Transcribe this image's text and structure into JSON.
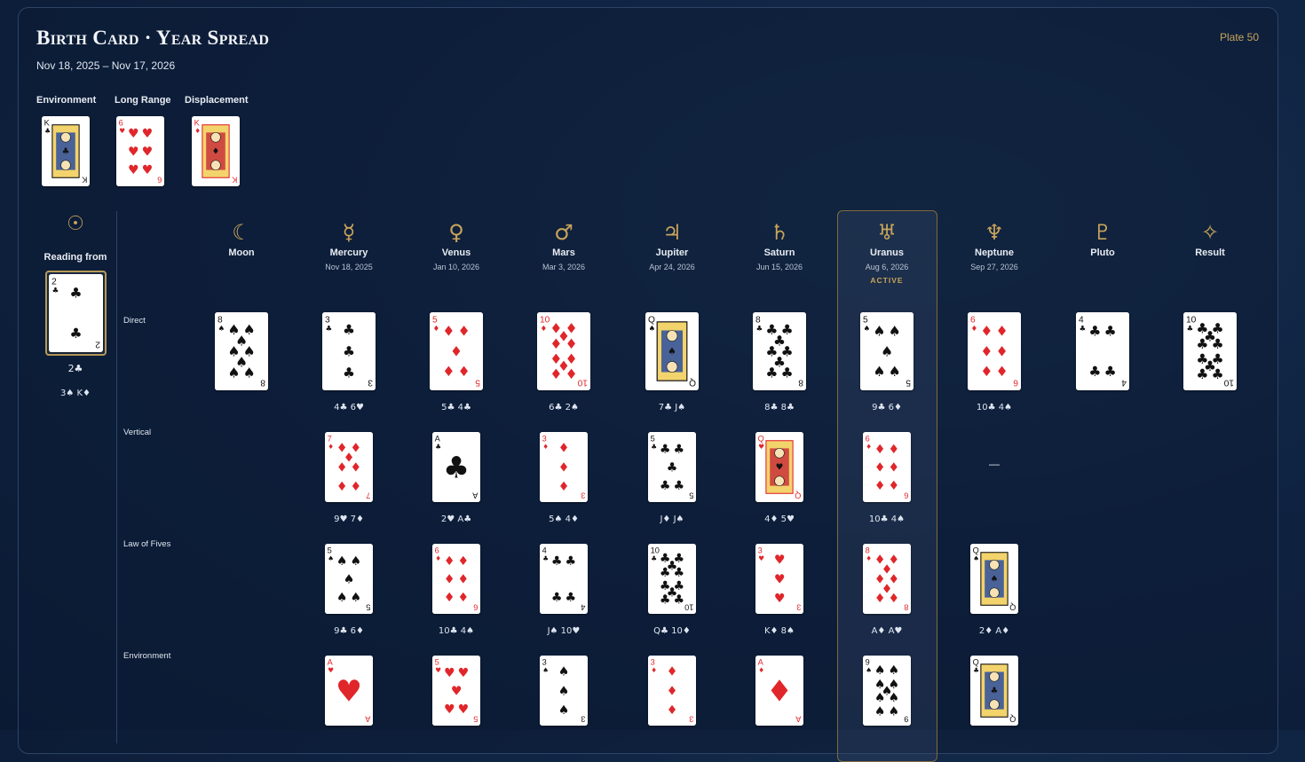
{
  "header": {
    "title": "Birth Card · Year Spread",
    "date_range": "Nov 18, 2025 – Nov 17, 2026",
    "plate": "Plate 50"
  },
  "top_cards": [
    {
      "label": "Environment",
      "card": "K♣"
    },
    {
      "label": "Long Range",
      "card": "6♥"
    },
    {
      "label": "Displacement",
      "card": "K♦"
    }
  ],
  "reading_from": {
    "icon": "sun-icon",
    "label": "Reading from",
    "card": "2♣",
    "card_name": "2♣",
    "pair": "3♠  K♦"
  },
  "row_labels": [
    "Direct",
    "Vertical",
    "Law of Fives",
    "Environment"
  ],
  "planets": [
    {
      "key": "moon",
      "icon": "moon-icon",
      "glyph": "☾",
      "name": "Moon",
      "date": "",
      "active": false
    },
    {
      "key": "mercury",
      "icon": "mercury-icon",
      "glyph": "☿",
      "name": "Mercury",
      "date": "Nov 18, 2025",
      "active": false
    },
    {
      "key": "venus",
      "icon": "venus-icon",
      "glyph": "♀",
      "name": "Venus",
      "date": "Jan 10, 2026",
      "active": false
    },
    {
      "key": "mars",
      "icon": "mars-icon",
      "glyph": "♂",
      "name": "Mars",
      "date": "Mar 3, 2026",
      "active": false
    },
    {
      "key": "jupiter",
      "icon": "jupiter-icon",
      "glyph": "♃",
      "name": "Jupiter",
      "date": "Apr 24, 2026",
      "active": false
    },
    {
      "key": "saturn",
      "icon": "saturn-icon",
      "glyph": "♄",
      "name": "Saturn",
      "date": "Jun 15, 2026",
      "active": false
    },
    {
      "key": "uranus",
      "icon": "uranus-icon",
      "glyph": "♅",
      "name": "Uranus",
      "date": "Aug 6, 2026",
      "active": true
    },
    {
      "key": "neptune",
      "icon": "neptune-icon",
      "glyph": "♆",
      "name": "Neptune",
      "date": "Sep 27, 2026",
      "active": false
    },
    {
      "key": "pluto",
      "icon": "pluto-icon",
      "glyph": "♇",
      "name": "Pluto",
      "date": "",
      "active": false
    },
    {
      "key": "result",
      "icon": "sparkle-icon",
      "glyph": "✧",
      "name": "Result",
      "date": "",
      "active": false
    }
  ],
  "active_label": "ACTIVE",
  "direct": [
    {
      "card": "8♠",
      "pair": ""
    },
    {
      "card": "3♣",
      "pair": "4♣  6♥"
    },
    {
      "card": "5♦",
      "pair": "5♣  4♣"
    },
    {
      "card": "10♦",
      "pair": "6♣  2♠"
    },
    {
      "card": "Q♠",
      "pair": "7♣  J♠"
    },
    {
      "card": "8♣",
      "pair": "8♣  8♣"
    },
    {
      "card": "5♠",
      "pair": "9♣  6♦"
    },
    {
      "card": "6♦",
      "pair": "10♣  4♠"
    },
    {
      "card": "4♣",
      "pair": ""
    },
    {
      "card": "10♣",
      "pair": ""
    }
  ],
  "vertical": [
    null,
    {
      "card": "7♦",
      "pair": "9♥  7♦"
    },
    {
      "card": "A♣",
      "pair": "2♥  A♣"
    },
    {
      "card": "3♦",
      "pair": "5♠  4♦"
    },
    {
      "card": "5♣",
      "pair": "J♦  J♠"
    },
    {
      "card": "Q♥",
      "pair": "4♦  5♥"
    },
    {
      "card": "6♦",
      "pair": "10♣  4♠"
    },
    {
      "card": "",
      "pair": "—"
    },
    null,
    null
  ],
  "law_of_fives": [
    null,
    {
      "card": "5♠",
      "pair": "9♣  6♦"
    },
    {
      "card": "6♦",
      "pair": "10♣  4♠"
    },
    {
      "card": "4♣",
      "pair": "J♠  10♥"
    },
    {
      "card": "10♣",
      "pair": "Q♣  10♦"
    },
    {
      "card": "3♥",
      "pair": "K♦  8♠"
    },
    {
      "card": "8♦",
      "pair": "A♦  A♥"
    },
    {
      "card": "Q♠",
      "pair": "2♦  A♦"
    },
    null,
    null
  ],
  "environment_row": [
    null,
    {
      "card": "A♥",
      "pair": ""
    },
    {
      "card": "5♥",
      "pair": ""
    },
    {
      "card": "3♠",
      "pair": ""
    },
    {
      "card": "3♦",
      "pair": ""
    },
    {
      "card": "A♦",
      "pair": ""
    },
    {
      "card": "9♠",
      "pair": ""
    },
    {
      "card": "Q♣",
      "pair": ""
    },
    null,
    null
  ],
  "colors": {
    "accent_gold": "#c9a45a",
    "red_suit": "#e0262a",
    "black_suit": "#111111",
    "background": "#0f2342"
  }
}
